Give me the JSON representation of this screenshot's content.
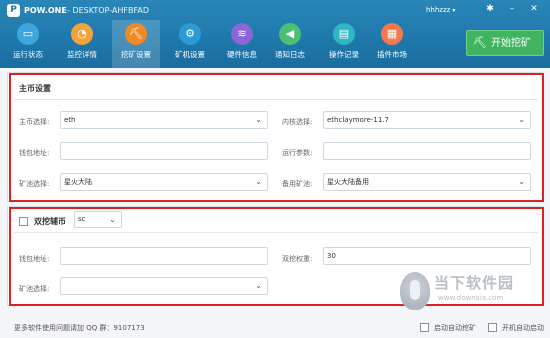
{
  "app": {
    "brand": "POW.ONE",
    "machine": "DESKTOP-AHFBFAD",
    "user": "hhhzzz"
  },
  "nav": [
    {
      "label": "运行状态",
      "icon": "monitor-icon",
      "glyph": "▭",
      "color": "#3ea6dd"
    },
    {
      "label": "监控详情",
      "icon": "speedometer-icon",
      "glyph": "◔",
      "color": "#f2a33a"
    },
    {
      "label": "挖矿设置",
      "icon": "pickaxe-icon",
      "glyph": "⛏",
      "color": "#f08a24"
    },
    {
      "label": "矿机设置",
      "icon": "gear-icon",
      "glyph": "⚙",
      "color": "#2a9bd6"
    },
    {
      "label": "硬件信息",
      "icon": "layers-icon",
      "glyph": "≋",
      "color": "#8a66d6"
    },
    {
      "label": "通知日志",
      "icon": "speaker-icon",
      "glyph": "◀",
      "color": "#4bbf73"
    },
    {
      "label": "操作记录",
      "icon": "clipboard-icon",
      "glyph": "▤",
      "color": "#2fb6c4"
    },
    {
      "label": "插件市场",
      "icon": "store-icon",
      "glyph": "▦",
      "color": "#f27a4a"
    }
  ],
  "start_button": {
    "label": "开始挖矿",
    "icon": "pickaxe-icon"
  },
  "main_settings": {
    "title": "主币设置",
    "coin_label": "主币选择:",
    "coin_value": "eth",
    "kernel_label": "内核选择:",
    "kernel_value": "ethclaymore-11.7",
    "wallet_label": "钱包地址:",
    "wallet_value": "",
    "params_label": "运行参数:",
    "params_value": "",
    "pool_label": "矿池选择:",
    "pool_value": "星火大陆",
    "backup_pool_label": "备用矿池:",
    "backup_pool_value": "星火大陆备用"
  },
  "dual_settings": {
    "title": "双挖辅币",
    "coin_value": "sc",
    "wallet_label": "钱包地址:",
    "wallet_value": "",
    "weight_label": "双挖权重:",
    "weight_value": "30",
    "pool_label": "矿池选择:",
    "pool_value": ""
  },
  "footer": {
    "qq_text": "更多软件使用问题请加 QQ 群：9107173",
    "auto_mine": "启动自动挖矿",
    "auto_start": "开机自动启动"
  },
  "watermark": {
    "title": "当下软件园",
    "url": "www.downxia.com"
  }
}
